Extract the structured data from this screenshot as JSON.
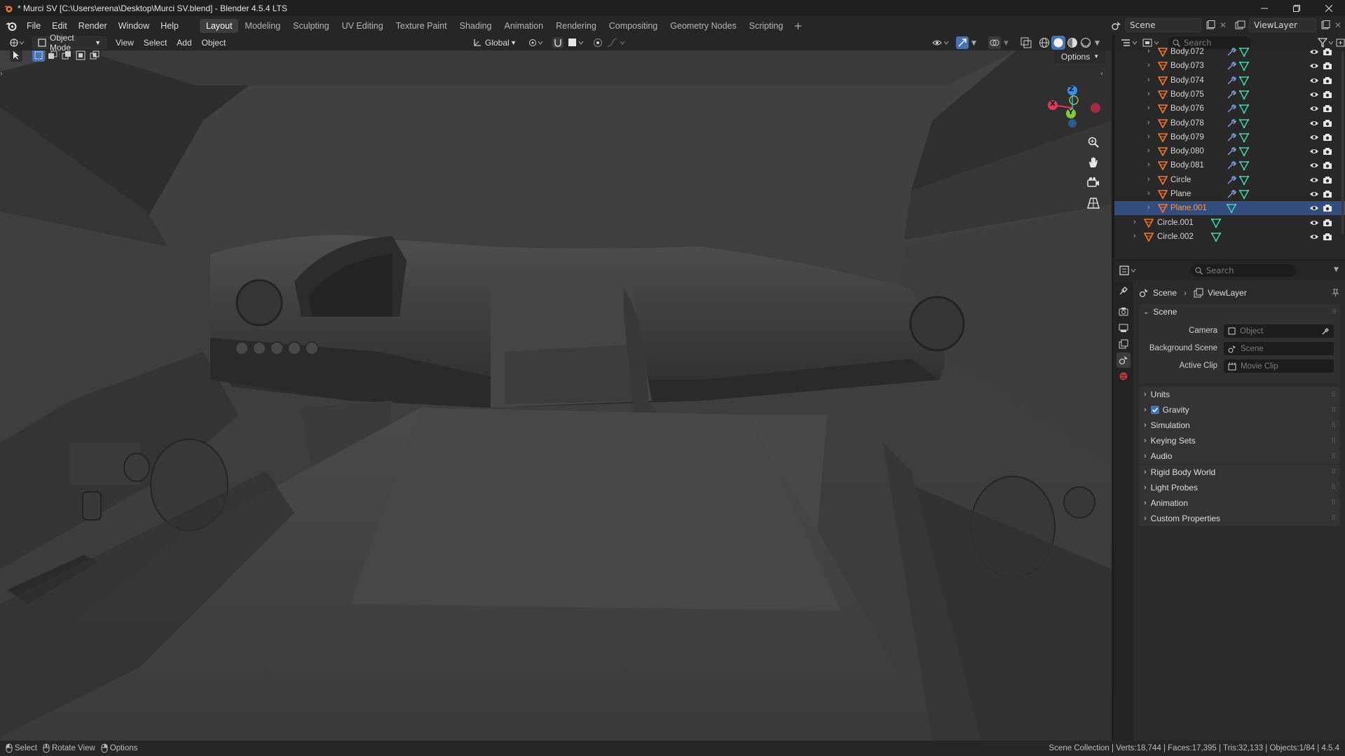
{
  "window": {
    "title": "* Murci SV [C:\\Users\\erena\\Desktop\\Murci SV.blend] - Blender 4.5.4 LTS"
  },
  "menubar": {
    "menus": [
      "File",
      "Edit",
      "Render",
      "Window",
      "Help"
    ],
    "workspaces": [
      "Layout",
      "Modeling",
      "Sculpting",
      "UV Editing",
      "Texture Paint",
      "Shading",
      "Animation",
      "Rendering",
      "Compositing",
      "Geometry Nodes",
      "Scripting"
    ],
    "active_workspace": "Layout",
    "scene_name": "Scene",
    "view_layer_name": "ViewLayer"
  },
  "viewport_header": {
    "mode": "Object Mode",
    "menus": [
      "View",
      "Select",
      "Add",
      "Object"
    ],
    "orientation": "Global",
    "options_label": "Options"
  },
  "gizmo": {
    "x": "X",
    "y": "Y",
    "z": "Z"
  },
  "outliner": {
    "search_placeholder": "Search",
    "items": [
      {
        "name": "Body.072",
        "modifier": true,
        "selected": false
      },
      {
        "name": "Body.073",
        "modifier": true,
        "selected": false
      },
      {
        "name": "Body.074",
        "modifier": true,
        "selected": false
      },
      {
        "name": "Body.075",
        "modifier": true,
        "selected": false
      },
      {
        "name": "Body.076",
        "modifier": true,
        "selected": false
      },
      {
        "name": "Body.078",
        "modifier": true,
        "selected": false
      },
      {
        "name": "Body.079",
        "modifier": true,
        "selected": false
      },
      {
        "name": "Body.080",
        "modifier": true,
        "selected": false
      },
      {
        "name": "Body.081",
        "modifier": true,
        "selected": false
      },
      {
        "name": "Circle",
        "modifier": true,
        "selected": false
      },
      {
        "name": "Plane",
        "modifier": true,
        "selected": false
      },
      {
        "name": "Plane.001",
        "modifier": false,
        "selected": true
      },
      {
        "name": "Circle.001",
        "modifier": false,
        "selected": false
      },
      {
        "name": "Circle.002",
        "modifier": false,
        "selected": false
      }
    ]
  },
  "properties": {
    "search_placeholder": "Search",
    "breadcrumb": {
      "scene": "Scene",
      "view_layer": "ViewLayer"
    },
    "scene_panel": {
      "title": "Scene",
      "camera_label": "Camera",
      "camera_placeholder": "Object",
      "background_scene_label": "Background Scene",
      "background_scene_placeholder": "Scene",
      "active_clip_label": "Active Clip",
      "active_clip_placeholder": "Movie Clip"
    },
    "panels": [
      "Units",
      "Gravity",
      "Simulation",
      "Keying Sets",
      "Audio",
      "Rigid Body World",
      "Light Probes",
      "Animation",
      "Custom Properties"
    ],
    "gravity_checked": true
  },
  "statusbar": {
    "hints": [
      "Select",
      "Rotate View",
      "Options"
    ],
    "stats": "Scene Collection | Verts:18,744 | Faces:17,395 | Tris:32,133 | Objects:1/84 | 4.5.4"
  },
  "colors": {
    "accent_orange": "#f5792a",
    "selection_blue": "#334d80",
    "axis_x": "#e0395a",
    "axis_y": "#86c83c",
    "axis_z": "#3a8ee8"
  }
}
